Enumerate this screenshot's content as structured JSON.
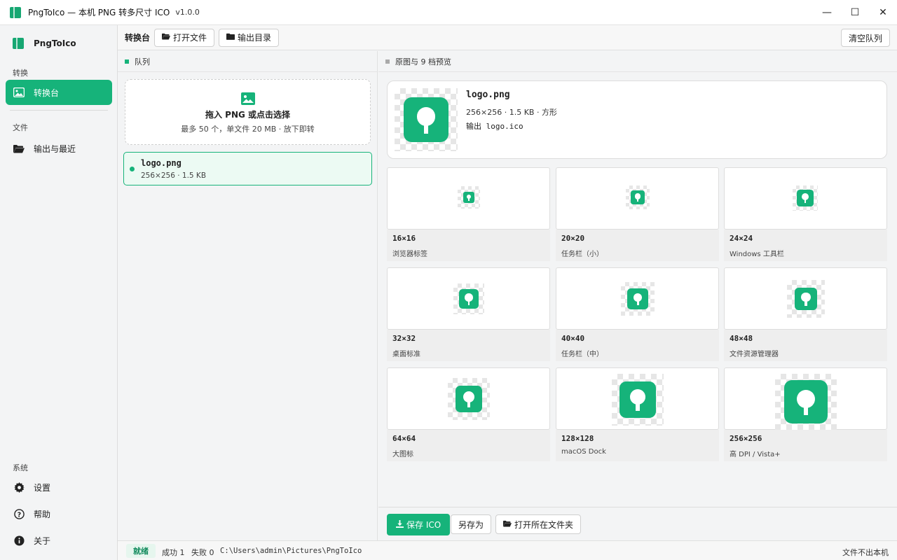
{
  "window": {
    "title": "PngToIco — 本机 PNG 转多尺寸 ICO",
    "version": "v1.0.0",
    "minimize_glyph": "—",
    "maximize_glyph": "☐",
    "close_glyph": "✕"
  },
  "sidebar": {
    "brand": "PngToIco",
    "sections": {
      "convert": "转换",
      "file": "文件",
      "system": "系统"
    },
    "items": {
      "workbench": "转换台",
      "output_recent": "输出与最近",
      "settings": "设置",
      "help": "帮助",
      "about": "关于"
    }
  },
  "toolbar": {
    "title": "转换台",
    "open_file": "打开文件",
    "output_dir": "输出目录",
    "clear_queue": "清空队列"
  },
  "queue": {
    "heading": "队列",
    "dropzone": {
      "title": "拖入 PNG 或点击选择",
      "subtitle": "最多 50 个，单文件 20 MB · 放下即转"
    },
    "items": [
      {
        "name": "logo.png",
        "meta": "256×256 · 1.5 KB"
      }
    ]
  },
  "preview": {
    "heading": "原图与 9 档预览",
    "file": {
      "name": "logo.png",
      "meta": "256×256 · 1.5 KB · 方形",
      "output": "输出 logo.ico"
    },
    "sizes": [
      {
        "size": "16×16",
        "desc": "浏览器标签"
      },
      {
        "size": "20×20",
        "desc": "任务栏（小）"
      },
      {
        "size": "24×24",
        "desc": "Windows 工具栏"
      },
      {
        "size": "32×32",
        "desc": "桌面标准"
      },
      {
        "size": "40×40",
        "desc": "任务栏（中）"
      },
      {
        "size": "48×48",
        "desc": "文件资源管理器"
      },
      {
        "size": "64×64",
        "desc": "大图标"
      },
      {
        "size": "128×128",
        "desc": "macOS Dock"
      },
      {
        "size": "256×256",
        "desc": "高 DPI / Vista+"
      }
    ]
  },
  "actions": {
    "save": "保存 ICO",
    "save_as": "另存为",
    "open_folder": "打开所在文件夹"
  },
  "status": {
    "state": "就绪",
    "success": "成功 1",
    "fail": "失败 0",
    "path": "C:\\Users\\admin\\Pictures\\PngToIco",
    "note": "文件不出本机"
  },
  "colors": {
    "accent": "#16b37a",
    "accent_dark": "#16a772"
  }
}
